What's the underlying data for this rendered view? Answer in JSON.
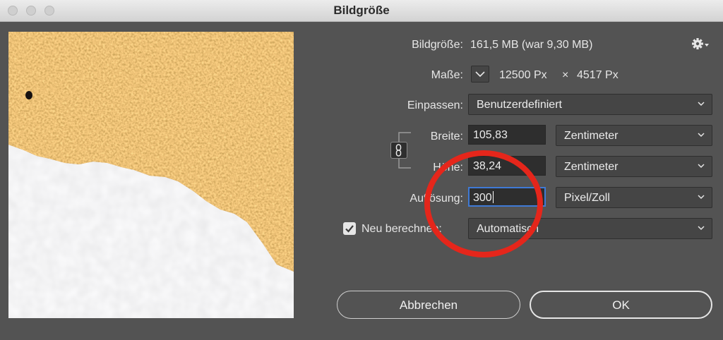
{
  "window": {
    "title": "Bildgröße"
  },
  "image_size": {
    "label": "Bildgröße:",
    "value": "161,5 MB (war 9,30 MB)"
  },
  "dimensions": {
    "label": "Maße:",
    "width": "12500 Px",
    "times": "×",
    "height": "4517 Px"
  },
  "fit_to": {
    "label": "Einpassen:",
    "value": "Benutzerdefiniert"
  },
  "width": {
    "label": "Breite:",
    "value": "105,83",
    "unit": "Zentimeter"
  },
  "height": {
    "label": "Höhe:",
    "value": "38,24",
    "unit": "Zentimeter"
  },
  "resolution": {
    "label": "Auflösung:",
    "value": "300",
    "unit": "Pixel/Zoll"
  },
  "resample": {
    "label": "Neu berechnen:",
    "checked": true,
    "value": "Automatisch"
  },
  "buttons": {
    "cancel": "Abbrechen",
    "ok": "OK"
  },
  "colors": {
    "background": "#535353",
    "focus": "#3f7ad6",
    "annotation": "#e5261b"
  },
  "icons": [
    "gear-icon",
    "chain-link-icon",
    "chevron-down-icon",
    "checkmark-icon"
  ]
}
